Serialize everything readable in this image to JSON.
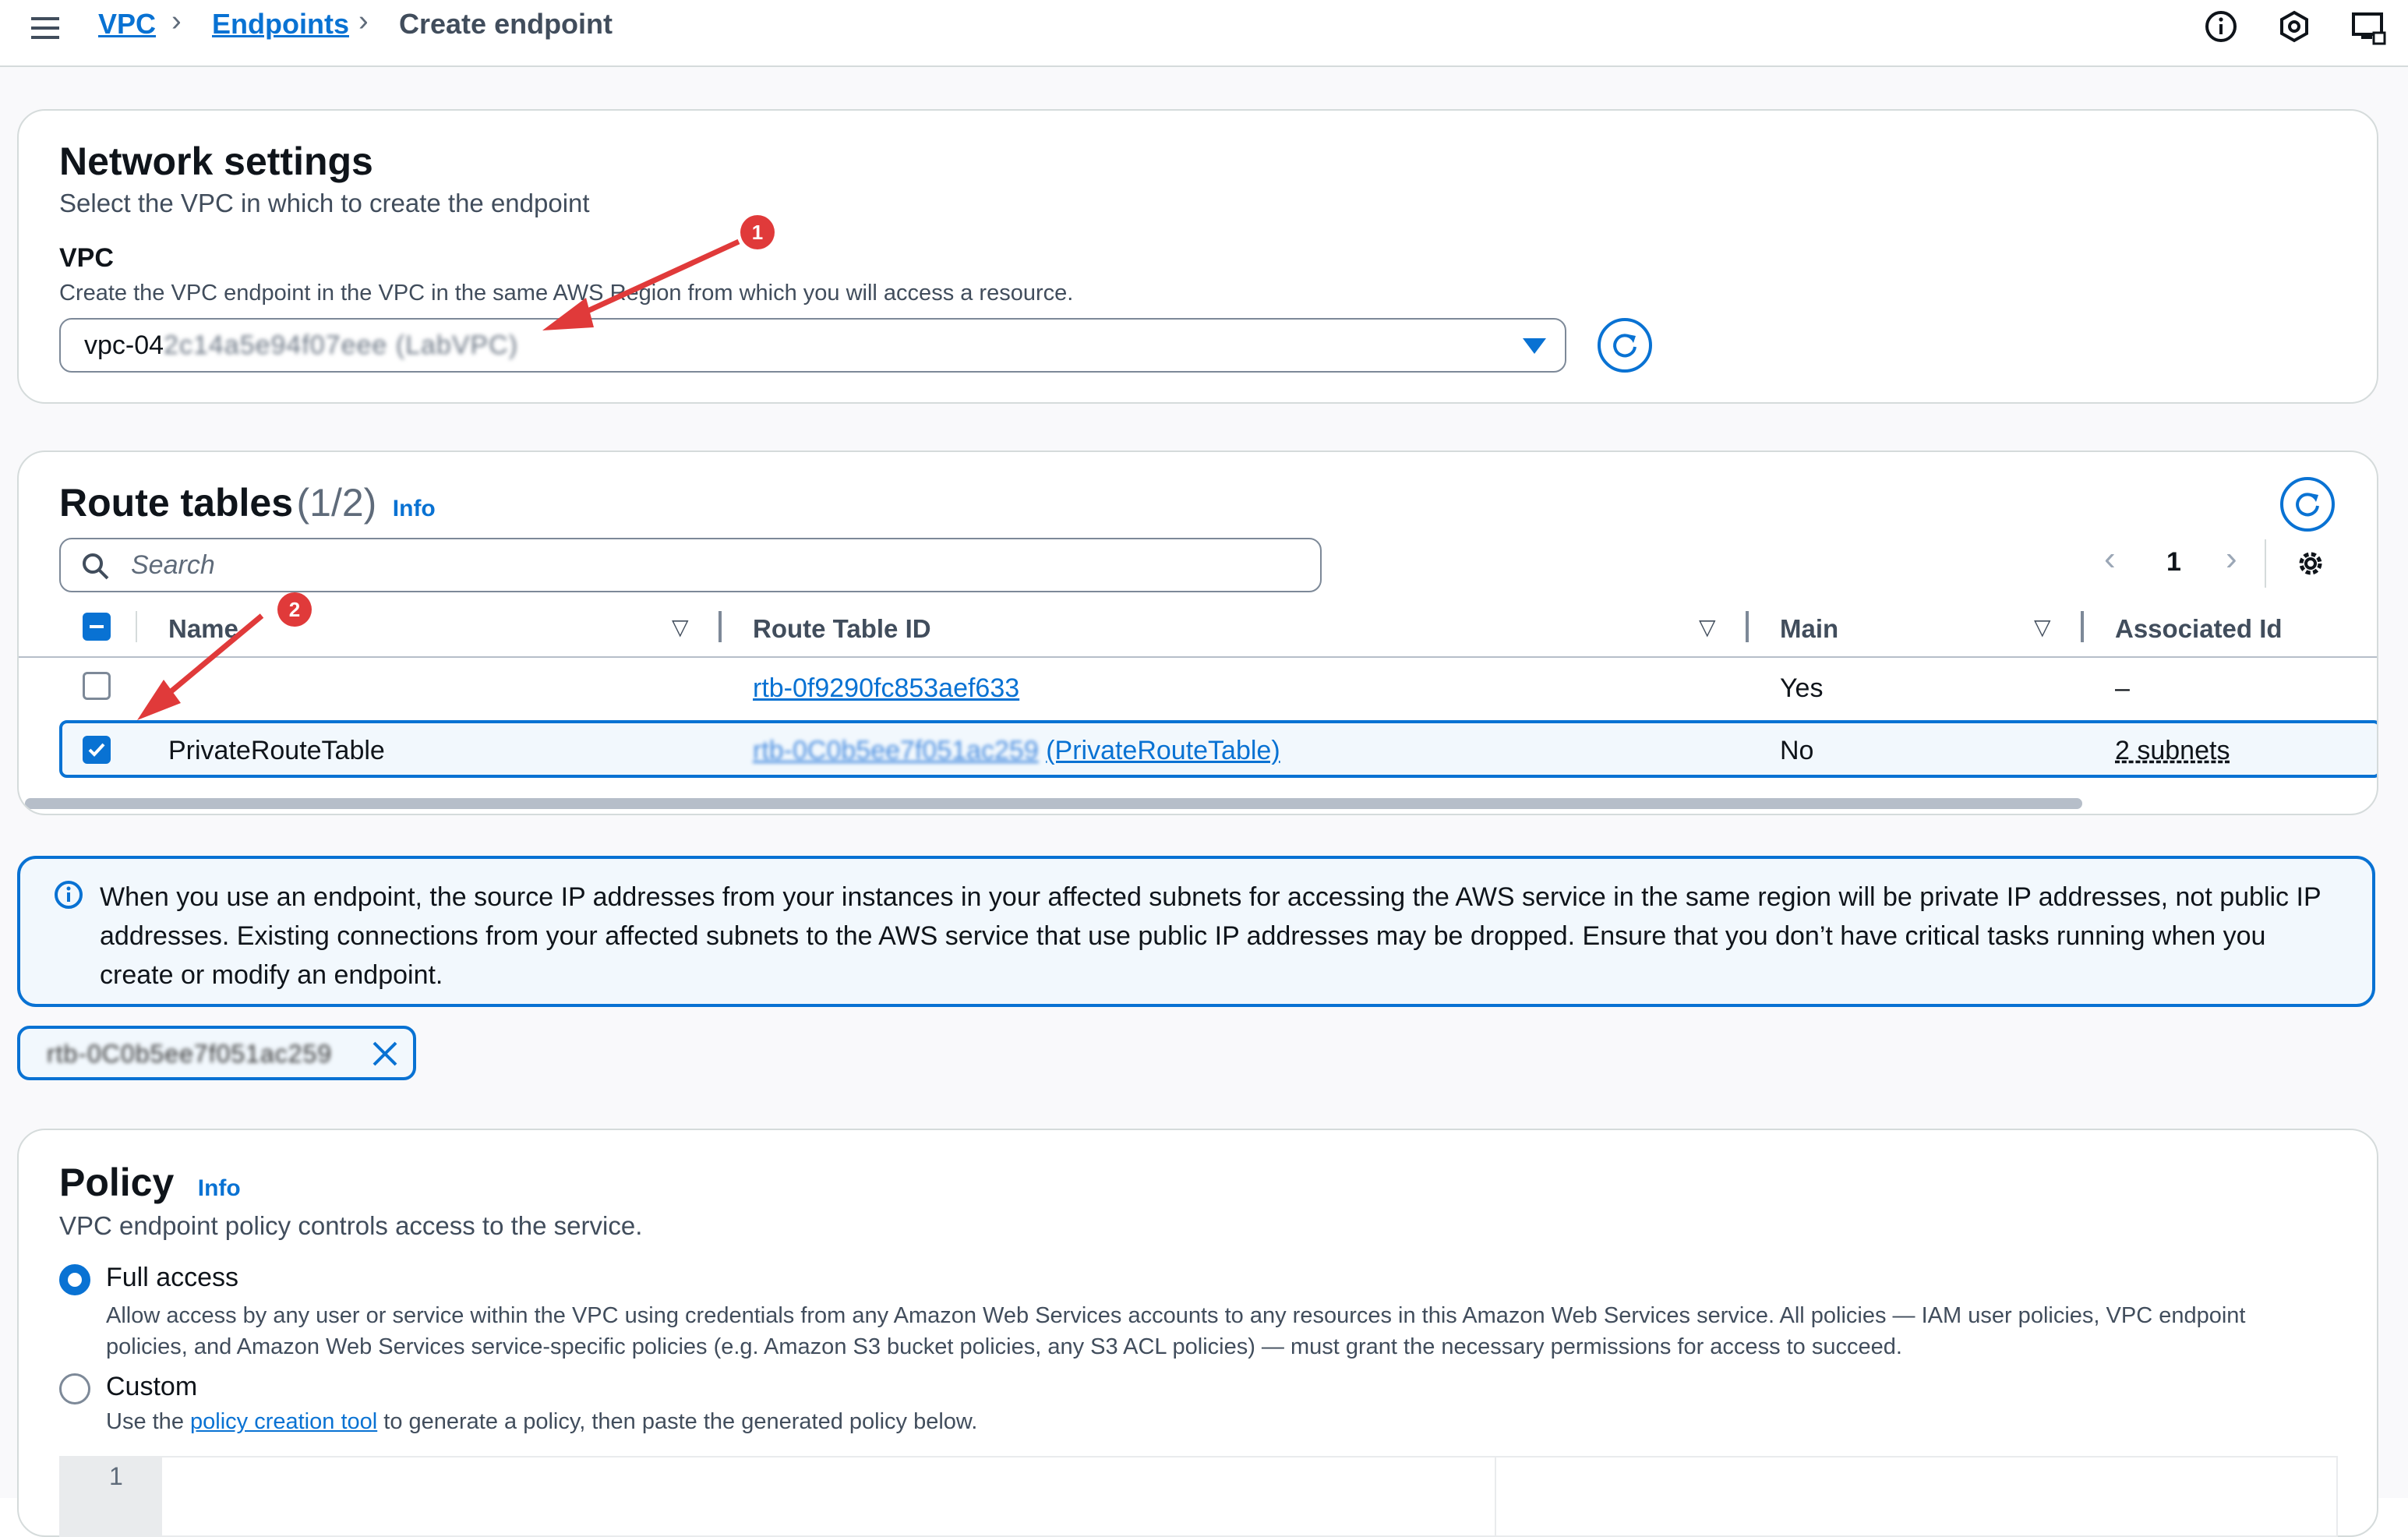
{
  "breadcrumb": [
    "VPC",
    "Endpoints",
    "Create endpoint"
  ],
  "network": {
    "title": "Network settings",
    "subtitle": "Select the VPC in which to create the endpoint",
    "vpc_label": "VPC",
    "vpc_desc": "Create the VPC endpoint in the VPC in the same AWS Region from which you will access a resource.",
    "vpc_value_prefix": "vpc-04",
    "vpc_value_hidden": "2c14a5e94f07eee (LabVPC)"
  },
  "route_tables": {
    "title": "Route tables",
    "count": "(1/2)",
    "info": "Info",
    "search_placeholder": "Search",
    "page": "1",
    "columns": [
      "Name",
      "Route Table ID",
      "Main",
      "Associated Id"
    ],
    "rows": [
      {
        "name": "",
        "id": "rtb-0f9290fc853aef633",
        "main": "Yes",
        "assoc": "–",
        "selected": false
      },
      {
        "name": "PrivateRouteTable",
        "id_hidden": "rtb-0C0b5ee7f051ac259",
        "id_suffix": "(PrivateRouteTable)",
        "main": "No",
        "assoc": "2 subnets",
        "selected": true
      }
    ]
  },
  "alert": {
    "text": "When you use an endpoint, the source IP addresses from your instances in your affected subnets for accessing the AWS service in the same region will be private IP addresses, not public IP addresses. Existing connections from your affected subnets to the AWS service that use public IP addresses may be dropped. Ensure that you don’t have critical tasks running when you create or modify an endpoint."
  },
  "token": {
    "value_hidden": "rtb-0C0b5ee7f051ac259"
  },
  "policy": {
    "title": "Policy",
    "info": "Info",
    "desc": "VPC endpoint policy controls access to the service.",
    "full_label": "Full access",
    "full_desc": "Allow access by any user or service within the VPC using credentials from any Amazon Web Services accounts to any resources in this Amazon Web Services service. All policies — IAM user policies, VPC endpoint policies, and Amazon Web Services service-specific policies (e.g. Amazon S3 bucket policies, any S3 ACL policies) — must grant the necessary permissions for access to succeed.",
    "custom_label": "Custom",
    "custom_desc_pre": "Use the",
    "custom_link": "policy creation tool",
    "custom_desc_post": "to generate a policy, then paste the generated policy below.",
    "editor_line": "1"
  },
  "annotations": [
    "1",
    "2"
  ],
  "colors": {
    "accent": "#0972d3",
    "annotation": "#e03a3a",
    "selected_row": "#f2f8fd",
    "alert_bg": "#f2f8fd"
  }
}
